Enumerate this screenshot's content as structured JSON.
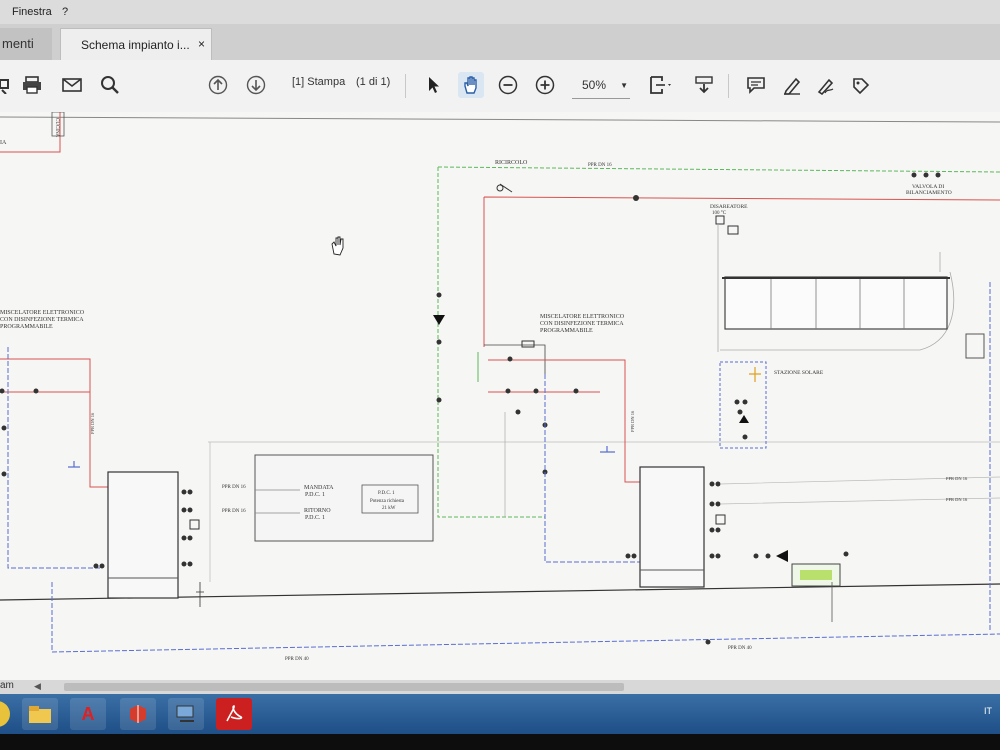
{
  "menubar": {
    "item1": "Finestra",
    "item2": "?"
  },
  "tabs": {
    "home_label": "menti",
    "doc_label": "Schema impianto i...",
    "close": "×"
  },
  "toolbar": {
    "page_indicator": "[1] Stampa",
    "page_count": "(1 di 1)",
    "zoom_value": "50%"
  },
  "drawing": {
    "ricircolo": "RICIRCOLO",
    "ppr_dn16": "PPR DN 16",
    "valvola_1": "VALVOLA DI",
    "valvola_2": "BILANCIAMENTO",
    "disareatore": "DISAREATORE",
    "temp100": "100 °C",
    "misc_left_1": "MISCELATORE ELETTRONICO",
    "misc_left_2": "CON DISINFEZIONE TERMICA",
    "misc_left_3": "PROGRAMMABILE",
    "misc_mid_1": "MISCELATORE ELETTRONICO",
    "misc_mid_2": "CON DISINFEZIONE TERMICA",
    "misc_mid_3": "PROGRAMMABILE",
    "stazione_solare": "STAZIONE SOLARE",
    "mandata": "MANDATA",
    "pdc1_a": "P.D.C. 1",
    "ritorno": "RITORNO",
    "pdc1_b": "P.D.C. 1",
    "pdc_box_1": "P.D.C. 1",
    "pdc_box_2": "Potenza richiesta",
    "pdc_box_3": "21 kW",
    "ppr_dn16_l1": "PPR DN 16",
    "ppr_dn16_l2": "PPR DN 16",
    "ppr_dn16_r1": "PPR DN 16",
    "ppr_dn16_r2": "PPR DN 16",
    "ppr_dn40": "PPR DN 40",
    "cucina": "CUCINA",
    "sala": "IA"
  },
  "status": {
    "zoom_small": "am"
  },
  "colors": {
    "red_pipe": "#d9534f",
    "green_pipe": "#5cb85c",
    "blue_pipe": "#5a6fd1",
    "taskbar": "#2a5d95"
  }
}
